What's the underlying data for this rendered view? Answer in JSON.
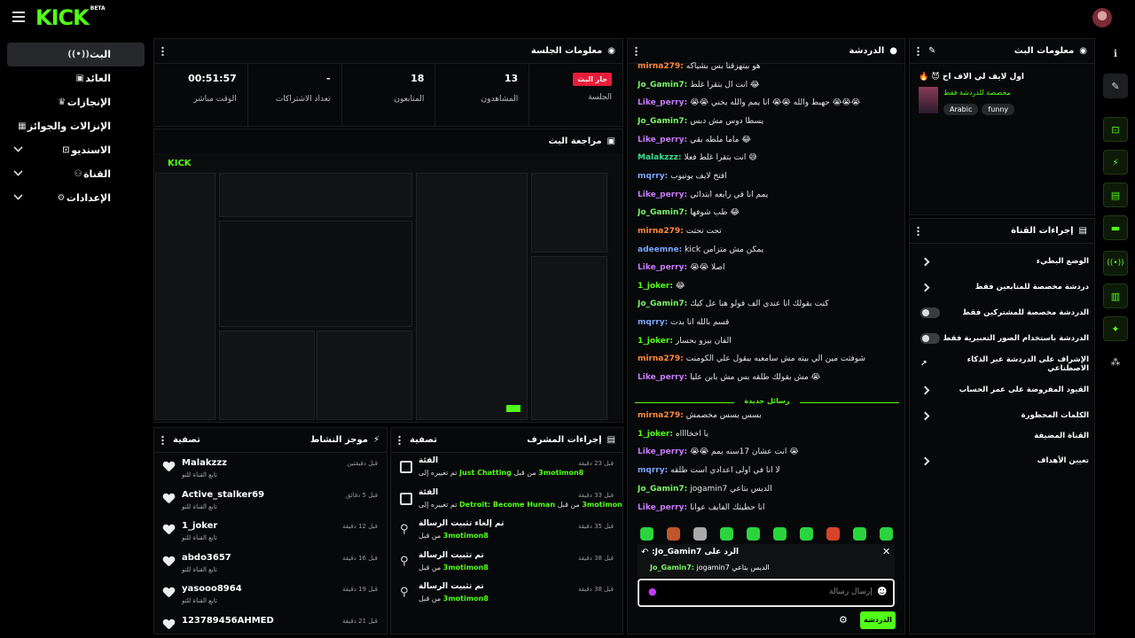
{
  "header": {
    "logo": "KICK",
    "logo_badge": "BETA"
  },
  "sidebar": {
    "items": [
      {
        "label": "البث",
        "icon": "broadcast-icon"
      },
      {
        "label": "العائد",
        "icon": "wallet-icon"
      },
      {
        "label": "الإنجازات",
        "icon": "trophy-icon"
      },
      {
        "label": "الإنزالات والجوائز",
        "icon": "gift-icon"
      },
      {
        "label": "الاستديو",
        "icon": "studio-icon"
      },
      {
        "label": "القناة",
        "icon": "channel-icon"
      },
      {
        "label": "الإعدادات",
        "icon": "gear-icon"
      }
    ]
  },
  "session": {
    "title": "معلومات الجلسة",
    "live_badge": "جار البث",
    "stats": [
      {
        "value": "",
        "label": "الجلسة"
      },
      {
        "value": "13",
        "label": "المشاهدون"
      },
      {
        "value": "18",
        "label": "المتابعون"
      },
      {
        "value": "-",
        "label": "تعداد الاشتراكات"
      },
      {
        "value": "00:51:57",
        "label": "الوقت مباشر"
      }
    ]
  },
  "preview": {
    "title": "مراجعة البث"
  },
  "feed": {
    "title": "موجز النشاط",
    "filter": "تصفية",
    "items": [
      {
        "name": "Malakzzz",
        "sub": "تابع القناة للتو",
        "time": "قبل دقيقتين"
      },
      {
        "name": "Active_stalker69",
        "sub": "تابع القناة للتو",
        "time": "قبل 5 دقائق"
      },
      {
        "name": "1_joker",
        "sub": "تابع القناة للتو",
        "time": "قبل 12 دقيقة"
      },
      {
        "name": "abdo3657",
        "sub": "تابع القناة للتو",
        "time": "قبل 16 دقيقة"
      },
      {
        "name": "yasooo8964",
        "sub": "تابع القناة للتو",
        "time": "قبل 19 دقيقة"
      },
      {
        "name": "123789456AHMED",
        "sub": "",
        "time": "قبل 21 دقيقة"
      }
    ]
  },
  "modlog": {
    "title": "إجراءات المشرف",
    "filter": "تصفية",
    "items": [
      {
        "title": "الفئة",
        "sub_pre": "تم تغييره إلى",
        "sub_val": "Just Chatting",
        "sub_mid": "من قبل",
        "sub_user": "3motimon8",
        "time": "قبل 23 دقيقة",
        "icon": "category-icon"
      },
      {
        "title": "الفئة",
        "sub_pre": "تم تغييره إلى",
        "sub_val": "Detroit: Become Human",
        "sub_mid": "من قبل",
        "sub_user": "3motimon8",
        "time": "قبل 33 دقيقة",
        "icon": "category-icon"
      },
      {
        "title": "تم إلغاء تثبيت الرسالة",
        "sub_pre": "",
        "sub_val": "",
        "sub_mid": "من قبل",
        "sub_user": "3motimon8",
        "time": "قبل 35 دقيقة",
        "icon": "unpin-icon"
      },
      {
        "title": "تم تثبيت الرسالة",
        "sub_pre": "",
        "sub_val": "",
        "sub_mid": "من قبل",
        "sub_user": "3motimon8",
        "time": "قبل 38 دقيقة",
        "icon": "pin-icon"
      },
      {
        "title": "تم تثبيت الرسالة",
        "sub_pre": "",
        "sub_val": "",
        "sub_mid": "من قبل",
        "sub_user": "3motimon8",
        "time": "قبل 38 دقيقة",
        "icon": "pin-icon"
      }
    ]
  },
  "chat": {
    "title": "الدردشة",
    "messages": [
      {
        "user": "mirna279",
        "color": "#ff8a3d",
        "text": "هو بيتهزقنا بس بشياكه"
      },
      {
        "user": "Jo_Gamin7",
        "color": "#7cf56a",
        "text": "انت ال بتقرا غلط 😂"
      },
      {
        "user": "Like_perry",
        "color": "#c77dff",
        "text": "😭😭 حهبط والله 😭😭 انا يمم والله يخني 😭😭😭"
      },
      {
        "user": "Jo_Gamin7",
        "color": "#7cf56a",
        "text": "يسطا دوس مش دبس"
      },
      {
        "user": "Like_perry",
        "color": "#c77dff",
        "text": "ماما ملطه بقي 😂"
      },
      {
        "user": "Malakzzz",
        "color": "#3ddc97",
        "text": "انت بتقرا غلط فعلا 😅"
      },
      {
        "user": "mqrry",
        "color": "#7aa7ff",
        "text": "افتح لايف يوتيوب"
      },
      {
        "user": "Like_perry",
        "color": "#c77dff",
        "text": "يمم انا في رابعه ابتدائي"
      },
      {
        "user": "Jo_Gamin7",
        "color": "#7cf56a",
        "text": "طب شوفها 😂"
      },
      {
        "user": "mirna279",
        "color": "#ff8a3d",
        "text": "تحت تحتت"
      },
      {
        "user": "adeemne",
        "color": "#7aa7ff",
        "text": "kick يمكن مش متزامن"
      },
      {
        "user": "Like_perry",
        "color": "#c77dff",
        "text": "😭😭 اصلا"
      },
      {
        "user": "1_joker",
        "color": "#53fc18",
        "text": "😂"
      },
      {
        "user": "Jo_Gamin7",
        "color": "#7cf56a",
        "text": "كنت بقولك انا عندي الف فولو هنا عل كيك"
      },
      {
        "user": "mqrry",
        "color": "#7aa7ff",
        "text": "قسم بالله انا بدت"
      },
      {
        "user": "1_joker",
        "color": "#53fc18",
        "text": "الفان بيزو بحسار"
      },
      {
        "user": "mirna279",
        "color": "#ff8a3d",
        "text": "شوفتت مين الي بيته مش سامعيه بيقول علي الكومنت"
      },
      {
        "user": "Like_perry",
        "color": "#c77dff",
        "text": "مش بقولك طلقه بس مش بابن عليا 😭"
      }
    ],
    "new_messages": "رسائل جديدة",
    "new": [
      {
        "user": "mirna279",
        "color": "#ff8a3d",
        "text": "بسس بسس مخصمش"
      },
      {
        "user": "1_joker",
        "color": "#53fc18",
        "text": "يا اخخااااه"
      },
      {
        "user": "Like_perry",
        "color": "#c77dff",
        "text": "😭😭 انت عشان 17سنه يمم 😭"
      },
      {
        "user": "mqrry",
        "color": "#7aa7ff",
        "text": "لا انا في اولى اعدادي أست طلقه"
      },
      {
        "user": "Jo_Gamin7",
        "color": "#7cf56a",
        "text": "jogamin7 الديس بتاعي"
      },
      {
        "user": "Like_perry",
        "color": "#c77dff",
        "text": "انا حطيتك الفايف عوانا"
      }
    ],
    "reply": {
      "label": "الرد على",
      "user": "Jo_Gamin7:",
      "quote_user": "Jo_Gamin7:",
      "quote_text": "jogamin7 الديس بتاعي"
    },
    "input_placeholder": "إرسال رسالة",
    "send_label": "الدردشة"
  },
  "stream_info": {
    "title": "معلومات البث",
    "stream_title": "اول لايف لي الاف اح 😈 🔥",
    "subtitle": "مخصصة للدردشة فقط",
    "tags": [
      "Arabic",
      "funny"
    ]
  },
  "channel_actions": {
    "title": "إجراءات القناة",
    "items": [
      {
        "label": "الوضع البطيء",
        "control": "chevron"
      },
      {
        "label": "دردشة مخصصة للمتابعين فقط",
        "control": "chevron"
      },
      {
        "label": "الدردشة مخصصة للمشتركين فقط",
        "control": "toggle"
      },
      {
        "label": "الدردشة باستخدام الصور التعبيرية فقط",
        "control": "toggle"
      },
      {
        "label": "الإشراف على الدردشة عبر الذكاء الاصطناعي",
        "control": "external"
      },
      {
        "label": "القيود المفروضة على عمر الحساب",
        "control": "chevron"
      },
      {
        "label": "الكلمات المحظورة",
        "control": "chevron"
      },
      {
        "label": "القناة المضيفة",
        "control": "none"
      },
      {
        "label": "تعيين الأهداف",
        "control": "chevron"
      }
    ]
  }
}
